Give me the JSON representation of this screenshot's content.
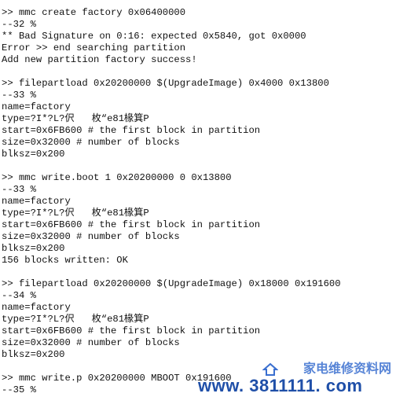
{
  "terminal": {
    "lines": [
      ">> mmc create factory 0x06400000",
      "--32 %",
      "** Bad Signature on 0:16: expected 0x5840, got 0x0000",
      "Error >> end searching partition",
      "Add new partition factory success!",
      "",
      ">> filepartload 0x20200000 $(UpgradeImage) 0x4000 0x13800",
      "--33 %",
      "name=factory",
      "type=?I*?L?伬   枚“e81椽箕P",
      "start=0x6FB600 # the first block in partition",
      "size=0x32000 # number of blocks",
      "blksz=0x200",
      "",
      ">> mmc write.boot 1 0x20200000 0 0x13800",
      "--33 %",
      "name=factory",
      "type=?I*?L?伬   枚“e81椽箕P",
      "start=0x6FB600 # the first block in partition",
      "size=0x32000 # number of blocks",
      "blksz=0x200",
      "156 blocks written: OK",
      "",
      ">> filepartload 0x20200000 $(UpgradeImage) 0x18000 0x191600",
      "--34 %",
      "name=factory",
      "type=?I*?L?伬   枚“e81椽箕P",
      "start=0x6FB600 # the first block in partition",
      "size=0x32000 # number of blocks",
      "blksz=0x200",
      "",
      ">> mmc write.p 0x20200000 MBOOT 0x191600",
      "--35 %"
    ]
  },
  "watermark": {
    "url": "www. 3811111. com",
    "site_name": "家电维修资料网",
    "color": "#1f4fa8"
  }
}
